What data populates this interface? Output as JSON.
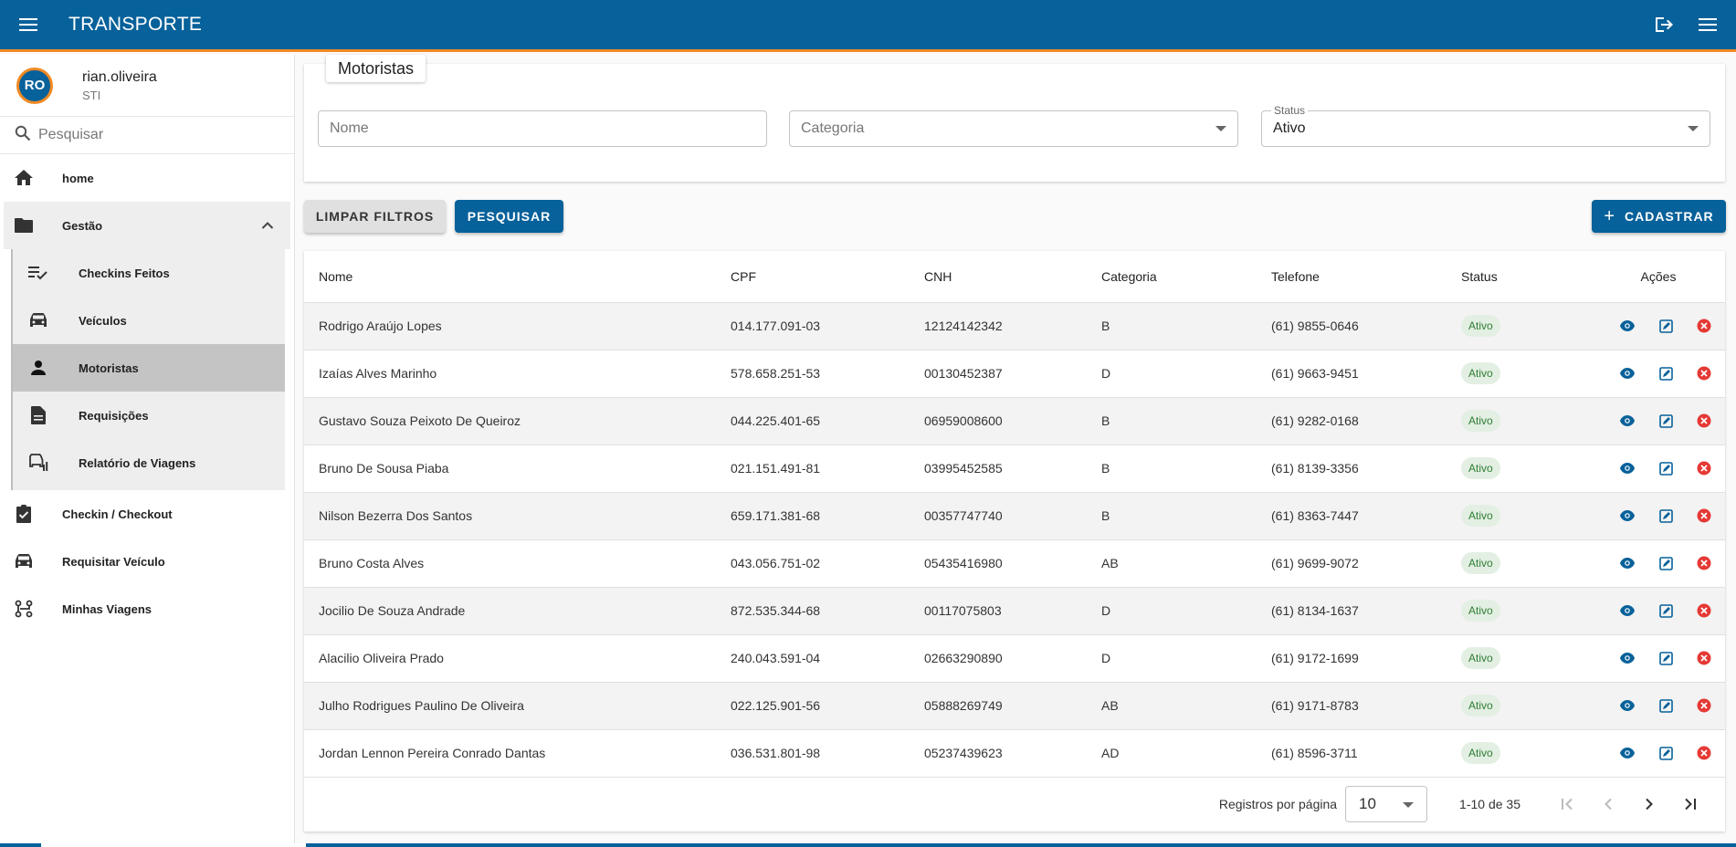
{
  "app": {
    "title": "TRANSPORTE",
    "colors": {
      "primary": "#07619a",
      "accent": "#f08a24",
      "status_active_bg": "#e3efe3",
      "status_active_text": "#2e7d32",
      "delete": "#e53935"
    }
  },
  "header": {
    "icons": [
      "menu-icon",
      "logout-icon",
      "menu-icon"
    ]
  },
  "user": {
    "initials": "RO",
    "name": "rian.oliveira",
    "role": "STI"
  },
  "sidebar": {
    "search_placeholder": "Pesquisar",
    "items": [
      {
        "label": "home",
        "icon": "home-icon"
      },
      {
        "label": "Gestão",
        "icon": "folder-icon",
        "expanded": true
      },
      {
        "label": "Checkin / Checkout",
        "icon": "clipboard-check-icon"
      },
      {
        "label": "Requisitar Veículo",
        "icon": "car-icon"
      },
      {
        "label": "Minhas Viagens",
        "icon": "route-icon"
      }
    ],
    "subitems": [
      {
        "label": "Checkins Feitos",
        "icon": "playlist-check-icon"
      },
      {
        "label": "Veículos",
        "icon": "car-icon"
      },
      {
        "label": "Motoristas",
        "icon": "person-icon",
        "active": true
      },
      {
        "label": "Requisições",
        "icon": "document-icon"
      },
      {
        "label": "Relatório de Viagens",
        "icon": "car-report-icon"
      }
    ]
  },
  "filters": {
    "title": "Motoristas",
    "nome_placeholder": "Nome",
    "categoria_placeholder": "Categoria",
    "status_label": "Status",
    "status_value": "Ativo"
  },
  "buttons": {
    "clear": "LIMPAR FILTROS",
    "search": "PESQUISAR",
    "create": "CADASTRAR"
  },
  "table": {
    "columns": [
      "Nome",
      "CPF",
      "CNH",
      "Categoria",
      "Telefone",
      "Status",
      "Ações"
    ],
    "rows": [
      {
        "nome": "Rodrigo Araújo Lopes",
        "cpf": "014.177.091-03",
        "cnh": "12124142342",
        "categoria": "B",
        "telefone": "(61) 9855-0646",
        "status": "Ativo"
      },
      {
        "nome": "Izaías Alves Marinho",
        "cpf": "578.658.251-53",
        "cnh": "00130452387",
        "categoria": "D",
        "telefone": "(61) 9663-9451",
        "status": "Ativo"
      },
      {
        "nome": "Gustavo Souza Peixoto De Queiroz",
        "cpf": "044.225.401-65",
        "cnh": "06959008600",
        "categoria": "B",
        "telefone": "(61) 9282-0168",
        "status": "Ativo"
      },
      {
        "nome": "Bruno De Sousa Piaba",
        "cpf": "021.151.491-81",
        "cnh": "03995452585",
        "categoria": "B",
        "telefone": "(61) 8139-3356",
        "status": "Ativo"
      },
      {
        "nome": "Nilson Bezerra Dos Santos",
        "cpf": "659.171.381-68",
        "cnh": "00357747740",
        "categoria": "B",
        "telefone": "(61) 8363-7447",
        "status": "Ativo"
      },
      {
        "nome": "Bruno Costa Alves",
        "cpf": "043.056.751-02",
        "cnh": "05435416980",
        "categoria": "AB",
        "telefone": "(61) 9699-9072",
        "status": "Ativo"
      },
      {
        "nome": "Jocilio De Souza Andrade",
        "cpf": "872.535.344-68",
        "cnh": "00117075803",
        "categoria": "D",
        "telefone": "(61) 8134-1637",
        "status": "Ativo"
      },
      {
        "nome": "Alacilio Oliveira Prado",
        "cpf": "240.043.591-04",
        "cnh": "02663290890",
        "categoria": "D",
        "telefone": "(61) 9172-1699",
        "status": "Ativo"
      },
      {
        "nome": "Julho Rodrigues Paulino De Oliveira",
        "cpf": "022.125.901-56",
        "cnh": "05888269749",
        "categoria": "AB",
        "telefone": "(61) 9171-8783",
        "status": "Ativo"
      },
      {
        "nome": "Jordan Lennon Pereira Conrado Dantas",
        "cpf": "036.531.801-98",
        "cnh": "05237439623",
        "categoria": "AD",
        "telefone": "(61) 8596-3711",
        "status": "Ativo"
      }
    ],
    "row_actions": [
      "eye-icon",
      "edit-icon",
      "delete-icon"
    ]
  },
  "pagination": {
    "rows_per_page_label": "Registros por página",
    "rows_per_page": "10",
    "range": "1-10 de 35",
    "icons": [
      "first-page-icon",
      "prev-page-icon",
      "next-page-icon",
      "last-page-icon"
    ]
  }
}
